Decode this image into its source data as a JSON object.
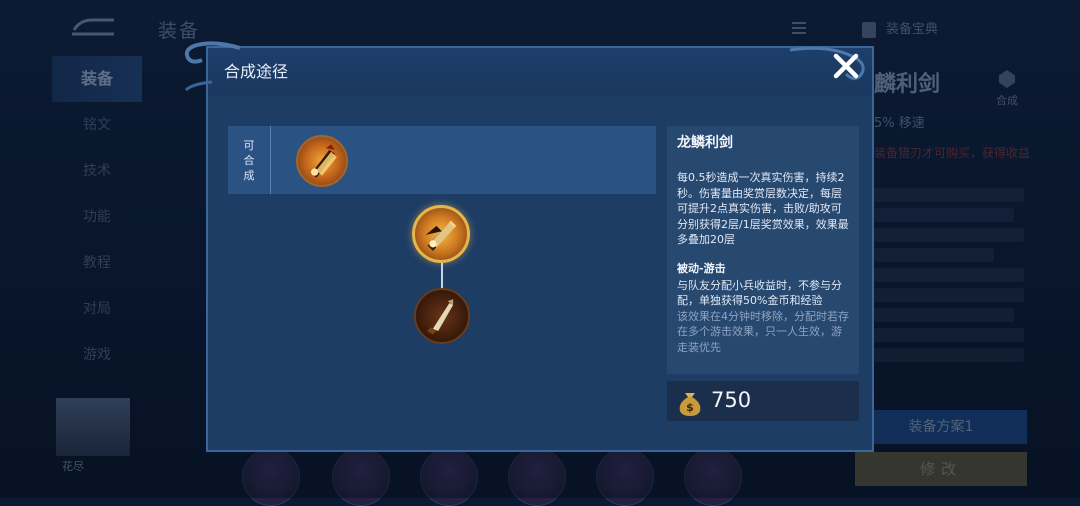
{
  "background": {
    "title": "装备",
    "nav_items": [
      "装备",
      "铭文",
      "技术",
      "功能",
      "教程",
      "对局",
      "游戏"
    ],
    "header_right": "装备宝典",
    "item_name": "麟利剑",
    "stat": "5% 移速",
    "compose_label": "合成",
    "red_note": "装备猎刃才可购买，获得收益",
    "plan_button": "装备方案1",
    "edit_button": "修改",
    "player_name": "花尽"
  },
  "modal": {
    "title": "合成途径",
    "recipe_label_chars": [
      "可",
      "合",
      "成"
    ],
    "item": {
      "name": "龙鳞利剑",
      "description": "每0.5秒造成一次真实伤害，持续2秒。伤害量由奖赏层数决定，每层可提升2点真实伤害，击败/助攻可分别获得2层/1层奖赏效果，效果最多叠加20层",
      "passive_title": "被动-游击",
      "passive_text": "与队友分配小兵收益时，不参与分配，单独获得50%金币和经验",
      "faded_text": "该效果在4分钟时移除，分配时若存在多个游击效果，只一人生效，游走装优先",
      "price": "750"
    },
    "icons": {
      "close": "close-icon",
      "money": "money-bag-icon",
      "recipe": "dragon-scale-blade-icon",
      "component": "hunting-blade-icon"
    }
  }
}
